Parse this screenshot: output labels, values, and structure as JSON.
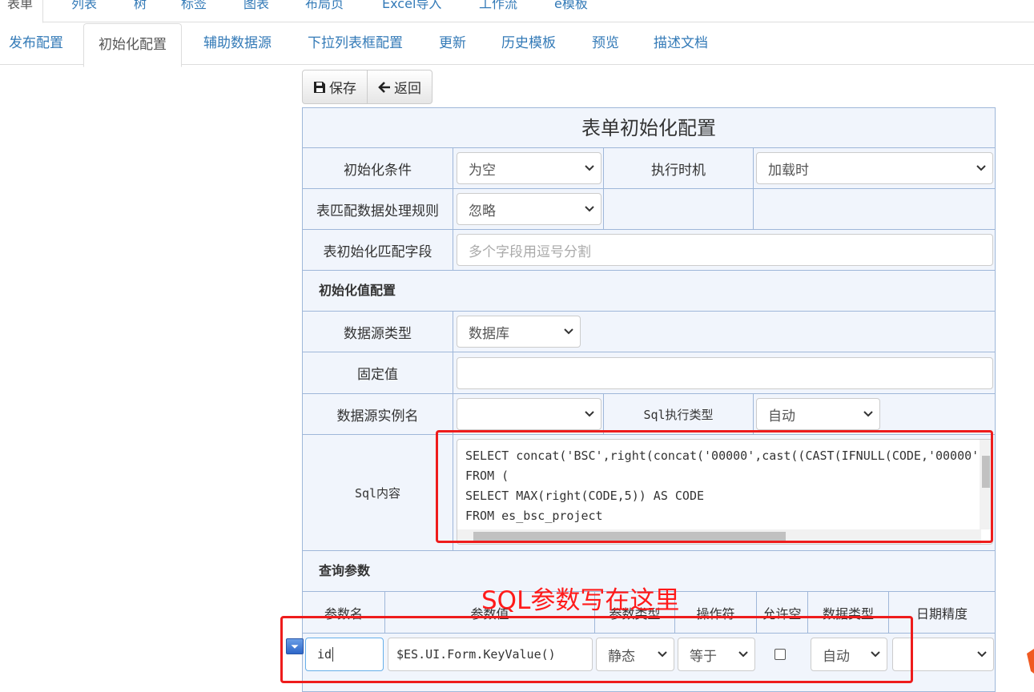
{
  "top_tabs": [
    "表单",
    "列表",
    "树",
    "标签",
    "图表",
    "布局页",
    "Excel导入",
    "工作流",
    "e模板"
  ],
  "sub_tabs": [
    "发布配置",
    "初始化配置",
    "辅助数据源",
    "下拉列表框配置",
    "更新",
    "历史模板",
    "预览",
    "描述文档"
  ],
  "active_sub_tab": "初始化配置",
  "toolbar": {
    "save_label": "保存",
    "back_label": "返回"
  },
  "form": {
    "title": "表单初始化配置",
    "init_condition": {
      "label": "初始化条件",
      "value": "为空"
    },
    "exec_timing": {
      "label": "执行时机",
      "value": "加载时"
    },
    "match_rule": {
      "label": "表匹配数据处理规则",
      "value": "忽略"
    },
    "match_fields": {
      "label": "表初始化匹配字段",
      "placeholder": "多个字段用逗号分割"
    },
    "init_value_section": "初始化值配置",
    "datasource_type": {
      "label": "数据源类型",
      "value": "数据库"
    },
    "fixed_value": {
      "label": "固定值",
      "value": ""
    },
    "datasource_instance": {
      "label": "数据源实例名",
      "value": ""
    },
    "sql_exec_type": {
      "label": "Sql执行类型",
      "value": "自动"
    },
    "sql_content": {
      "label": "Sql内容",
      "lines": [
        "SELECT concat('BSC',right(concat('00000',cast((CAST(IFNULL(CODE,'00000'",
        "FROM (",
        "SELECT MAX(right(CODE,5)) AS CODE",
        "FROM es_bsc_project"
      ]
    },
    "query_section": "查询参数",
    "param_headers": [
      "参数名",
      "参数值",
      "参数类型",
      "操作符",
      "允许空",
      "数据类型",
      "日期精度"
    ],
    "param_row": {
      "name": "id",
      "value": "$ES.UI.Form.KeyValue()",
      "type": "静态",
      "operator": "等于",
      "data_type": "自动",
      "date_precision": ""
    }
  },
  "annotation": "SQL参数写在这里"
}
